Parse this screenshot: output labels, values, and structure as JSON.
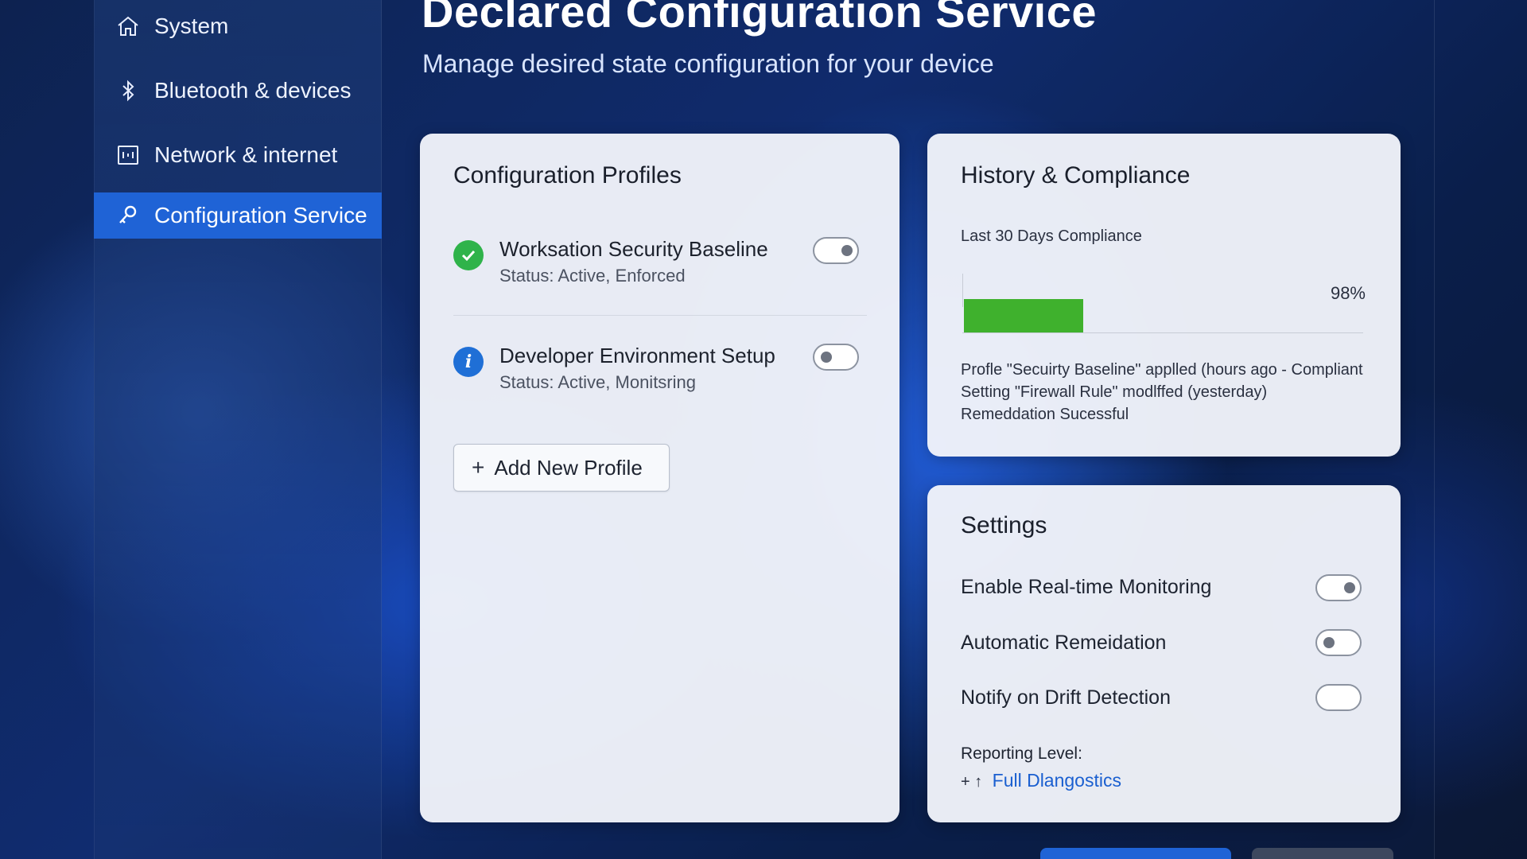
{
  "sidebar": {
    "items": [
      {
        "label": "System",
        "icon": "home-icon",
        "active": false
      },
      {
        "label": "Bluetooth & devices",
        "icon": "bluetooth-icon",
        "active": false
      },
      {
        "label": "Network & internet",
        "icon": "network-icon",
        "active": false
      },
      {
        "label": "Configuration Service",
        "icon": "key-icon",
        "active": true
      }
    ]
  },
  "header": {
    "title": "Declared Configuration Service",
    "subtitle": "Manage desired state configuration for your device"
  },
  "profiles": {
    "title": "Configuration Profiles",
    "items": [
      {
        "name": "Worksation Security Baseline",
        "status": "Status: Active, Enforced",
        "icon": "check-circle-icon",
        "icon_color": "#2fb34a",
        "toggle": "knob-right"
      },
      {
        "name": "Developer Environment Setup",
        "status": "Status: Active, Monitsring",
        "icon": "info-circle-icon",
        "icon_color": "#1f6fd6",
        "toggle": "knob-left"
      }
    ],
    "add_button_label": "Add New Profile",
    "add_button_icon": "plus-icon"
  },
  "history": {
    "title": "History & Compliance",
    "compliance_label": "Last 30 Days Compliance",
    "compliance_percent_text": "98%",
    "compliance_bar_fill": 0.3,
    "bar_color": "#3fb12d",
    "log": [
      "Profle \"Secuirty Baseline\" applled (hours ago - Compliant",
      "Setting \"Firewall Rule\" modlffed (yesterday)",
      "Remeddation Sucessful"
    ]
  },
  "settings": {
    "title": "Settings",
    "items": [
      {
        "label": "Enable Real-time Monitoring",
        "toggle": "knob-right"
      },
      {
        "label": "Automatic Remeidation",
        "toggle": "knob-left"
      },
      {
        "label": "Notify on Drift Detection",
        "toggle": "empty"
      }
    ],
    "reporting_label": "Reporting Level:",
    "reporting_prefix": "+ ↑",
    "reporting_value": "Full Dlangostics"
  },
  "colors": {
    "accent": "#1f63d6",
    "success": "#2fb34a",
    "info": "#1f6fd6",
    "link": "#1a5fd0"
  }
}
